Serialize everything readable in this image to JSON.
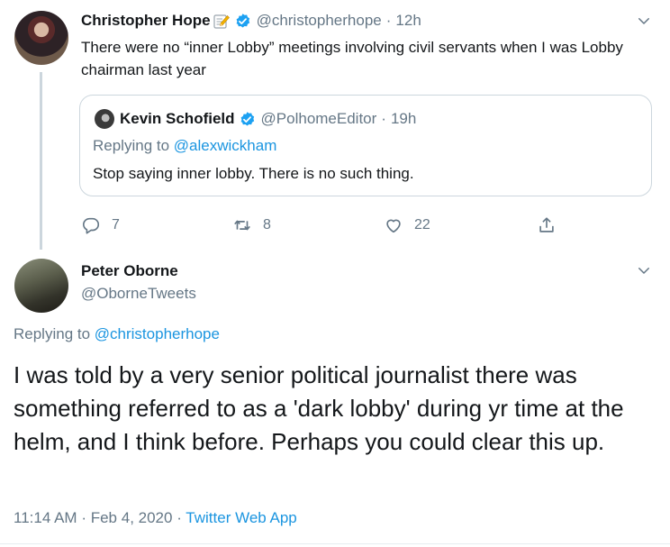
{
  "colors": {
    "text": "#14171a",
    "muted": "#657786",
    "link": "#1b95e0",
    "verified": "#1da1f2",
    "border": "#ccd6dd"
  },
  "top_tweet": {
    "display_name": "Christopher Hope",
    "name_emoji_icon": "memo-icon",
    "handle": "@christopherhope",
    "separator": "·",
    "time": "12h",
    "text": "There were no “inner Lobby” meetings involving civil servants when I was Lobby chairman last year",
    "quote": {
      "display_name": "Kevin Schofield",
      "handle": "@PolhomeEditor",
      "separator": "·",
      "time": "19h",
      "replying_prefix": "Replying to ",
      "replying_to": "@alexwickham",
      "text": "Stop saying inner lobby. There is no such thing."
    },
    "actions": {
      "replies": "7",
      "retweets": "8",
      "likes": "22"
    }
  },
  "reply_tweet": {
    "display_name": "Peter Oborne",
    "handle": "@OborneTweets",
    "replying_prefix": "Replying to ",
    "replying_to": "@christopherhope",
    "text": "I was told by a very senior political journalist there was something referred to as a 'dark lobby' during yr time at the helm, and I think before. Perhaps you could clear this up.",
    "time": "11:14 AM",
    "separator_1": "·",
    "date": "Feb 4, 2020",
    "separator_2": "·",
    "source": "Twitter Web App"
  }
}
